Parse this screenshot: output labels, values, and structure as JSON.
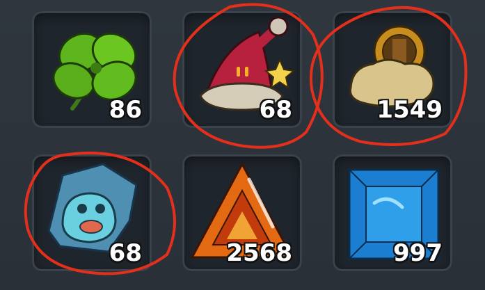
{
  "inventory": {
    "items": [
      {
        "icon": "four-leaf-clover-icon",
        "count": "86"
      },
      {
        "icon": "santa-hat-icon",
        "count": "68"
      },
      {
        "icon": "gold-coin-ore-icon",
        "count": "1549"
      },
      {
        "icon": "slime-fossil-icon",
        "count": "68"
      },
      {
        "icon": "fire-triangle-gem-icon",
        "count": "2568"
      },
      {
        "icon": "blue-square-gem-icon",
        "count": "997"
      }
    ]
  },
  "annotations": {
    "color": "#e3301c",
    "circled_slots": [
      1,
      2,
      3
    ]
  }
}
